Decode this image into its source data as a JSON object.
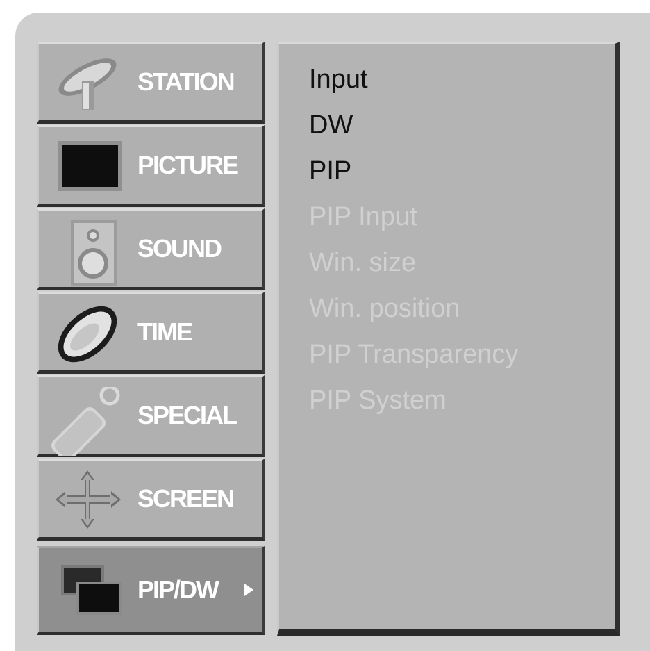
{
  "menu": {
    "items": [
      {
        "label": "STATION",
        "icon": "satellite-dish-icon"
      },
      {
        "label": "PICTURE",
        "icon": "tv-screen-icon"
      },
      {
        "label": "SOUND",
        "icon": "speaker-icon"
      },
      {
        "label": "TIME",
        "icon": "clock-icon"
      },
      {
        "label": "SPECIAL",
        "icon": "remote-key-icon"
      },
      {
        "label": "SCREEN",
        "icon": "move-arrows-icon"
      },
      {
        "label": "PIP/DW",
        "icon": "pip-windows-icon"
      }
    ],
    "active_index": 6
  },
  "submenu": {
    "options": [
      {
        "label": "Input",
        "enabled": true
      },
      {
        "label": "DW",
        "enabled": true
      },
      {
        "label": "PIP",
        "enabled": true
      },
      {
        "label": "PIP Input",
        "enabled": false
      },
      {
        "label": "Win. size",
        "enabled": false
      },
      {
        "label": "Win. position",
        "enabled": false
      },
      {
        "label": "PIP Transparency",
        "enabled": false
      },
      {
        "label": "PIP System",
        "enabled": false
      }
    ]
  },
  "colors": {
    "frame": "#cfcfcf",
    "menu_bg": "#b0b0b0",
    "menu_active_bg": "#8f8f8f",
    "panel_bg": "#b4b4b4",
    "label": "#ffffff",
    "option_enabled": "#111111",
    "option_disabled": "#d0d0d0"
  }
}
